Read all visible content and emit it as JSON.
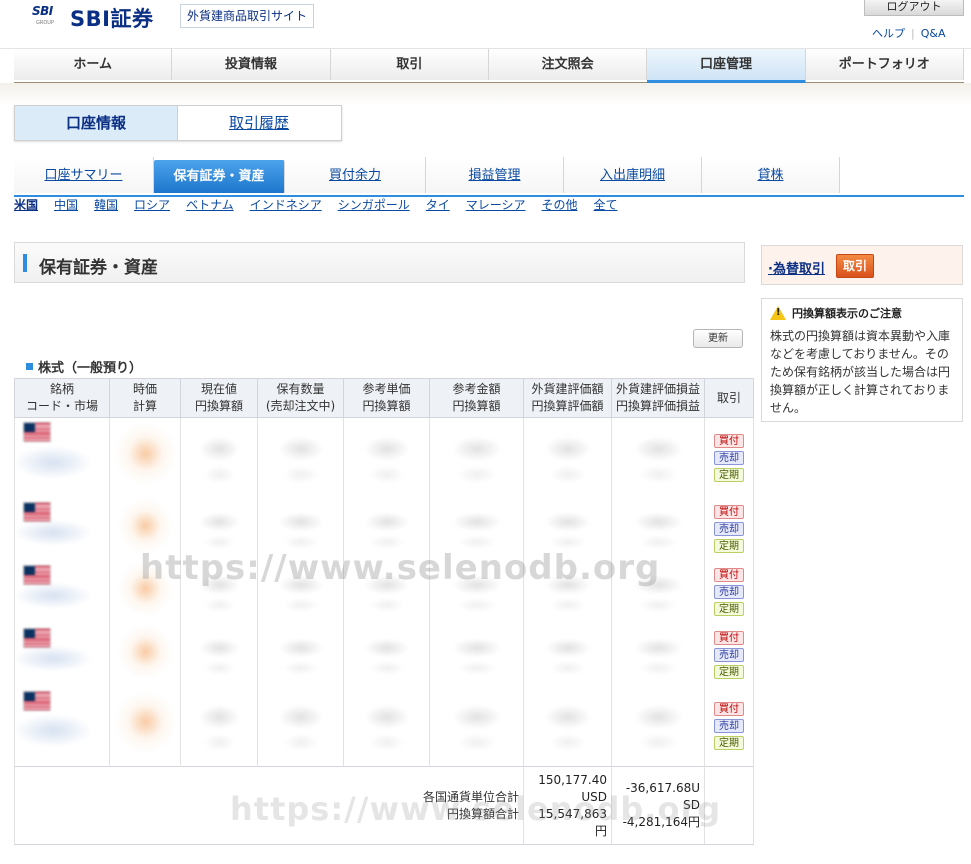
{
  "header": {
    "logo_mark": "SBI",
    "logo_group": "GROUP",
    "logo_text": "SBI証券",
    "site_label": "外貨建商品取引サイト",
    "logout": "ログアウト",
    "help": "ヘルプ",
    "qa": "Q&A"
  },
  "global_nav": [
    {
      "label": "ホーム"
    },
    {
      "label": "投資情報"
    },
    {
      "label": "取引"
    },
    {
      "label": "注文照会"
    },
    {
      "label": "口座管理",
      "active": true
    },
    {
      "label": "ポートフォリオ"
    }
  ],
  "subnav": {
    "account_info": "口座情報",
    "history": "取引履歴"
  },
  "section_tabs": [
    {
      "label": "口座サマリー"
    },
    {
      "label": "保有証券・資産",
      "active": true
    },
    {
      "label": "買付余力"
    },
    {
      "label": "損益管理"
    },
    {
      "label": "入出庫明細"
    },
    {
      "label": "貸株"
    }
  ],
  "countries": [
    "米国",
    "中国",
    "韓国",
    "ロシア",
    "ベトナム",
    "インドネシア",
    "シンガポール",
    "タイ",
    "マレーシア",
    "その他",
    "全て"
  ],
  "page": {
    "heading": "保有証券・資産",
    "refresh": "更新"
  },
  "side": {
    "fx_label": "為替取引",
    "fx_button": "取引",
    "notice_title": "円換算額表示のご注意",
    "notice_body": "株式の円換算額は資本異動や入庫などを考慮しておりません。そのため保有銘柄が該当した場合は円換算額が正しく計算されておりません。"
  },
  "holdings": {
    "title": "株式（一般預り）",
    "headers": [
      [
        "銘柄",
        "コード・市場"
      ],
      [
        "時価",
        "計算"
      ],
      [
        "現在値",
        "円換算額"
      ],
      [
        "保有数量",
        "(売却注文中)"
      ],
      [
        "参考単価",
        "円換算額"
      ],
      [
        "参考金額",
        "円換算額"
      ],
      [
        "外貨建評価額",
        "円換算評価額"
      ],
      [
        "外貨建評価損益",
        "円換算評価損益"
      ],
      [
        "取引"
      ]
    ],
    "trade_buttons": {
      "buy": "買付",
      "sell": "売却",
      "regular": "定期"
    },
    "rows": 5,
    "totals": {
      "label1": "各国通貨単位合計",
      "label2": "円換算額合計",
      "valuation_foreign_1": "150,177.40",
      "valuation_foreign_2": "USD",
      "valuation_jpy_1": "15,547,863",
      "valuation_jpy_2": "円",
      "pl_foreign_1": "-36,617.68U",
      "pl_foreign_2": "SD",
      "pl_jpy": "-4,281,164円"
    }
  },
  "watermark": "https://www.selenodb.org"
}
